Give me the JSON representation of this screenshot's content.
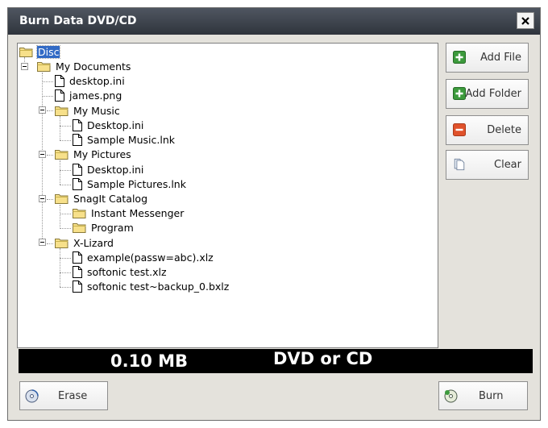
{
  "window": {
    "title": "Burn Data DVD/CD",
    "close_label": "×"
  },
  "tree": [
    {
      "label": "Disc",
      "type": "disc",
      "selected": true
    },
    {
      "label": "My Documents",
      "type": "folder"
    },
    {
      "label": "desktop.ini",
      "type": "file"
    },
    {
      "label": "james.png",
      "type": "file"
    },
    {
      "label": "My Music",
      "type": "folder"
    },
    {
      "label": "Desktop.ini",
      "type": "file"
    },
    {
      "label": "Sample Music.lnk",
      "type": "file"
    },
    {
      "label": "My Pictures",
      "type": "folder"
    },
    {
      "label": "Desktop.ini",
      "type": "file"
    },
    {
      "label": "Sample Pictures.lnk",
      "type": "file"
    },
    {
      "label": "SnagIt Catalog",
      "type": "folder"
    },
    {
      "label": "Instant Messenger",
      "type": "folder"
    },
    {
      "label": "Program",
      "type": "folder"
    },
    {
      "label": "X-Lizard",
      "type": "folder"
    },
    {
      "label": "example(passw=abc).xlz",
      "type": "file"
    },
    {
      "label": "softonic test.xlz",
      "type": "file"
    },
    {
      "label": "softonic test~backup_0.bxlz",
      "type": "file"
    }
  ],
  "buttons": {
    "add_file": "Add File",
    "add_folder": "Add Folder",
    "delete": "Delete",
    "clear": "Clear",
    "erase": "Erase",
    "burn": "Burn"
  },
  "status": {
    "size": "0.10 MB",
    "media": "DVD or CD"
  },
  "colors": {
    "titlebar": "#3a3f48",
    "selection": "#316ac5",
    "status_bg": "#000000",
    "add_icon": "#3c9a3c",
    "delete_icon": "#e0522b"
  }
}
